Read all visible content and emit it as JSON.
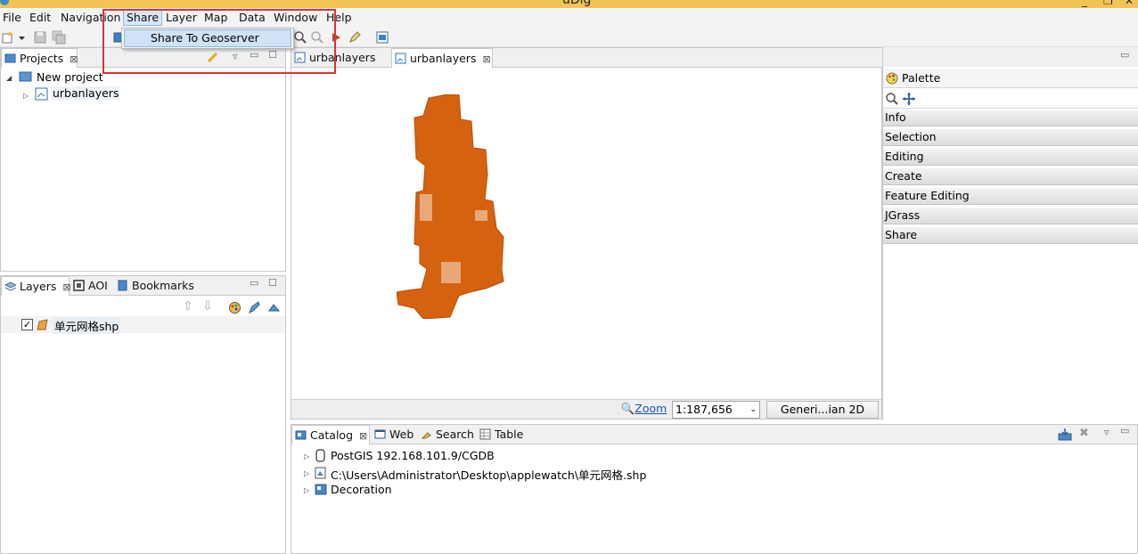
{
  "window": {
    "title": "uDig"
  },
  "menubar": {
    "items": [
      "File",
      "Edit",
      "Navigation",
      "Share",
      "Layer",
      "Map",
      "Data",
      "Window",
      "Help"
    ],
    "active": "Share"
  },
  "share_menu": {
    "items": [
      "Share To Geoserver"
    ]
  },
  "projects_panel": {
    "tab_label": "Projects",
    "tree": [
      {
        "label": "New project",
        "children": [
          "urbanlayers"
        ]
      }
    ]
  },
  "layers_panel": {
    "tabs": [
      "Layers",
      "AOI",
      "Bookmarks"
    ],
    "layers": [
      {
        "label": "单元网格shp",
        "checked": true
      }
    ]
  },
  "map_editor": {
    "tabs": [
      "urbanlayers",
      "urbanlayers"
    ],
    "active_tab": 1,
    "fill_color": "#d5620f",
    "zoom_label": "Zoom",
    "scale": "1:187,656",
    "crs_label": "Generi...ian 2D"
  },
  "palette": {
    "title": "Palette",
    "sections": [
      "Info",
      "Selection",
      "Editing",
      "Create",
      "Feature Editing",
      "JGrass",
      "Share"
    ]
  },
  "bottom_panel": {
    "tabs": [
      "Catalog",
      "Web",
      "Search",
      "Table"
    ],
    "catalog": [
      "PostGIS 192.168.101.9/CGDB",
      "C:\\Users\\Administrator\\Desktop\\applewatch\\单元网格.shp",
      "Decoration"
    ]
  }
}
